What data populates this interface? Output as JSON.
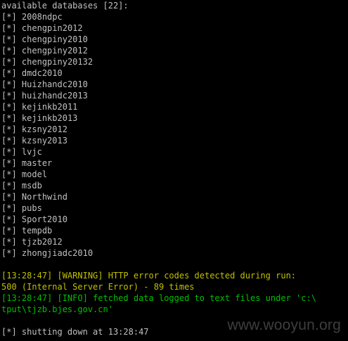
{
  "console": {
    "header": "available databases [22]:",
    "prefix": "[*]",
    "databases": [
      "2008ndpc",
      "chengpin2012",
      "chengpiny2010",
      "chengpiny2012",
      "chengpiny20132",
      "dmdc2010",
      "Huizhandc2010",
      "huizhandc2013",
      "kejinkb2011",
      "kejinkb2013",
      "kzsny2012",
      "kzsny2013",
      "lvjc",
      "master",
      "model",
      "msdb",
      "Northwind",
      "pubs",
      "Sport2010",
      "tempdb",
      "tjzb2012",
      "zhongjiadc2010"
    ],
    "warning_line_1": "[13:28:47] [WARNING] HTTP error codes detected during run:",
    "warning_line_2": "500 (Internal Server Error) - 89 times",
    "info_line_1": "[13:28:47] [INFO] fetched data logged to text files under 'c:\\",
    "info_line_2": "tput\\tjzb.bjes.gov.cn'",
    "shutdown": "[*] shutting down at 13:28:47",
    "watermark": "www.wooyun.org"
  },
  "colors": {
    "background": "#000000",
    "text": "#c0c0c0",
    "warning": "#c0c000",
    "info": "#00c000"
  }
}
